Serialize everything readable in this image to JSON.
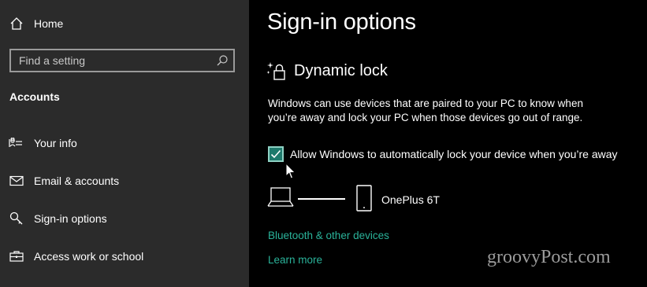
{
  "sidebar": {
    "home_label": "Home",
    "search_placeholder": "Find a setting",
    "section_title": "Accounts",
    "items": [
      {
        "label": "Your info",
        "icon": "person-card-icon"
      },
      {
        "label": "Email & accounts",
        "icon": "mail-icon"
      },
      {
        "label": "Sign-in options",
        "icon": "key-icon"
      },
      {
        "label": "Access work or school",
        "icon": "briefcase-icon"
      }
    ]
  },
  "main": {
    "title": "Sign-in options",
    "dynamic_lock": {
      "title": "Dynamic lock",
      "description": "Windows can use devices that are paired to your PC to know when you’re away and lock your PC when those devices go out of range.",
      "checkbox_label": "Allow Windows to automatically lock your device when you’re away",
      "checkbox_checked": true,
      "device_name": "OnePlus 6T"
    },
    "links": [
      "Bluetooth & other devices",
      "Learn more"
    ]
  },
  "watermark": "groovyPost.com",
  "colors": {
    "sidebar_bg": "#2b2b2b",
    "main_bg": "#000000",
    "accent": "#2ab39a",
    "checkbox_fill": "#1e7a6c"
  }
}
